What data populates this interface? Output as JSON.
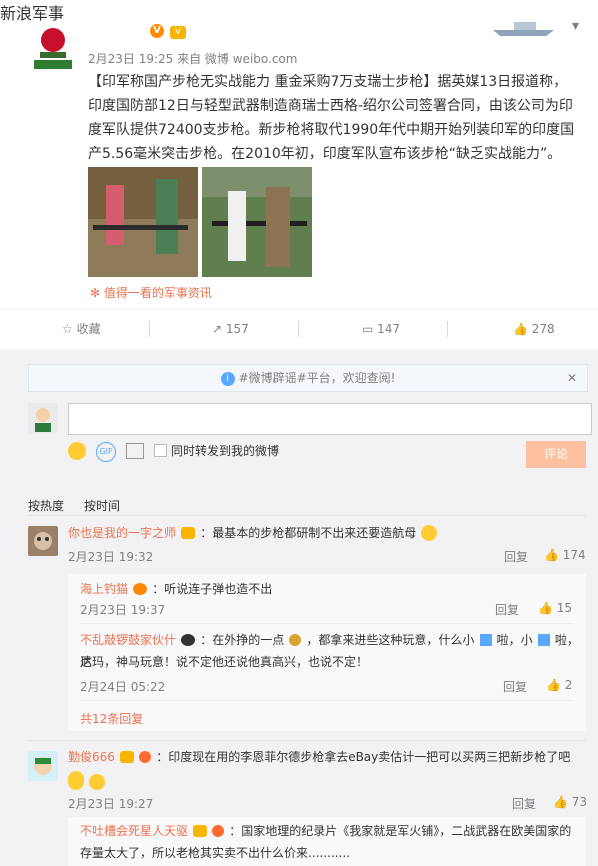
{
  "post": {
    "account_name": "新浪军事",
    "meta": "2月23日 19:25 来自 微博 weibo.com",
    "text": "【印军称国产步枪无实战能力 重金采购7万支瑞士步枪】据英媒13日报道称，印度国防部12日与轻型武器制造商瑞士西格-绍尔公司签署合同，由该公司为印度军队提供72400支步枪。新步枪将取代1990年代中期开始列装印军的印度国产5.56毫米突击步枪。在2010年初，印度军队宣布该步枪“缺乏实战能力”。",
    "sponsor": "值得一看的军事资讯"
  },
  "actions": {
    "favorite": "收藏",
    "reposts": "157",
    "comments": "147",
    "likes": "278"
  },
  "notice": {
    "text": "#微博辟谣#平台，欢迎查阅!"
  },
  "composer": {
    "checkbox_label": "同时转发到我的微博",
    "submit": "评论",
    "placeholder": ""
  },
  "sort_tabs": {
    "hot": "按热度",
    "time": "按时间"
  },
  "comments": [
    {
      "name": "你也是我的一字之师",
      "text": "：最基本的步枪都研制不出来还要造航母",
      "time": "2月23日 19:32",
      "reply_label": "回复",
      "likes": "174",
      "replies": [
        {
          "name": "海上钓猫",
          "text": "：听说连子弹也造不出",
          "time": "2月23日 19:37",
          "reply_label": "回复",
          "likes": "15"
        },
        {
          "name": "不乱敲锣鼓家伙什",
          "text_a": "：在外挣的一点",
          "text_b": "，都拿来进些这种玩意，什么小",
          "text_c": "啦，小",
          "text_d": "啦，达",
          "text_e": "尼玛，神马玩意！说不定他还说他真高兴，也说不定！",
          "time": "2月24日 05:22",
          "reply_label": "回复",
          "likes": "2"
        }
      ],
      "more": "共12条回复"
    },
    {
      "name": "勤俊666",
      "text": "：印度现在用的李恩菲尔德步枪拿去eBay卖估计一把可以买两三把新步枪了吧",
      "time": "2月23日 19:27",
      "reply_label": "回复",
      "likes": "73",
      "replies": [
        {
          "name": "不吐槽会死星人天驱",
          "text_a": "：国家地理的纪录片《我家就是军火铺》，二战武器在欧美国家的",
          "text_b": "存量太大了，所以老枪其实卖不出什么价来..........."
        }
      ]
    }
  ],
  "icons": {
    "verified": "verified-badge-icon",
    "vip": "vip-icon",
    "chevron": "chevron-down-icon",
    "info": "info-icon",
    "close": "close-icon",
    "emoji": "emoji-icon",
    "gif": "gif-icon",
    "image": "image-icon",
    "like": "thumb-up-icon",
    "repost": "repost-icon",
    "comment": "comment-icon",
    "star": "star-icon"
  },
  "colors": {
    "link": "#eb7350",
    "muted": "#808080",
    "background": "#f2f2f5",
    "submit": "#ffc09f"
  }
}
